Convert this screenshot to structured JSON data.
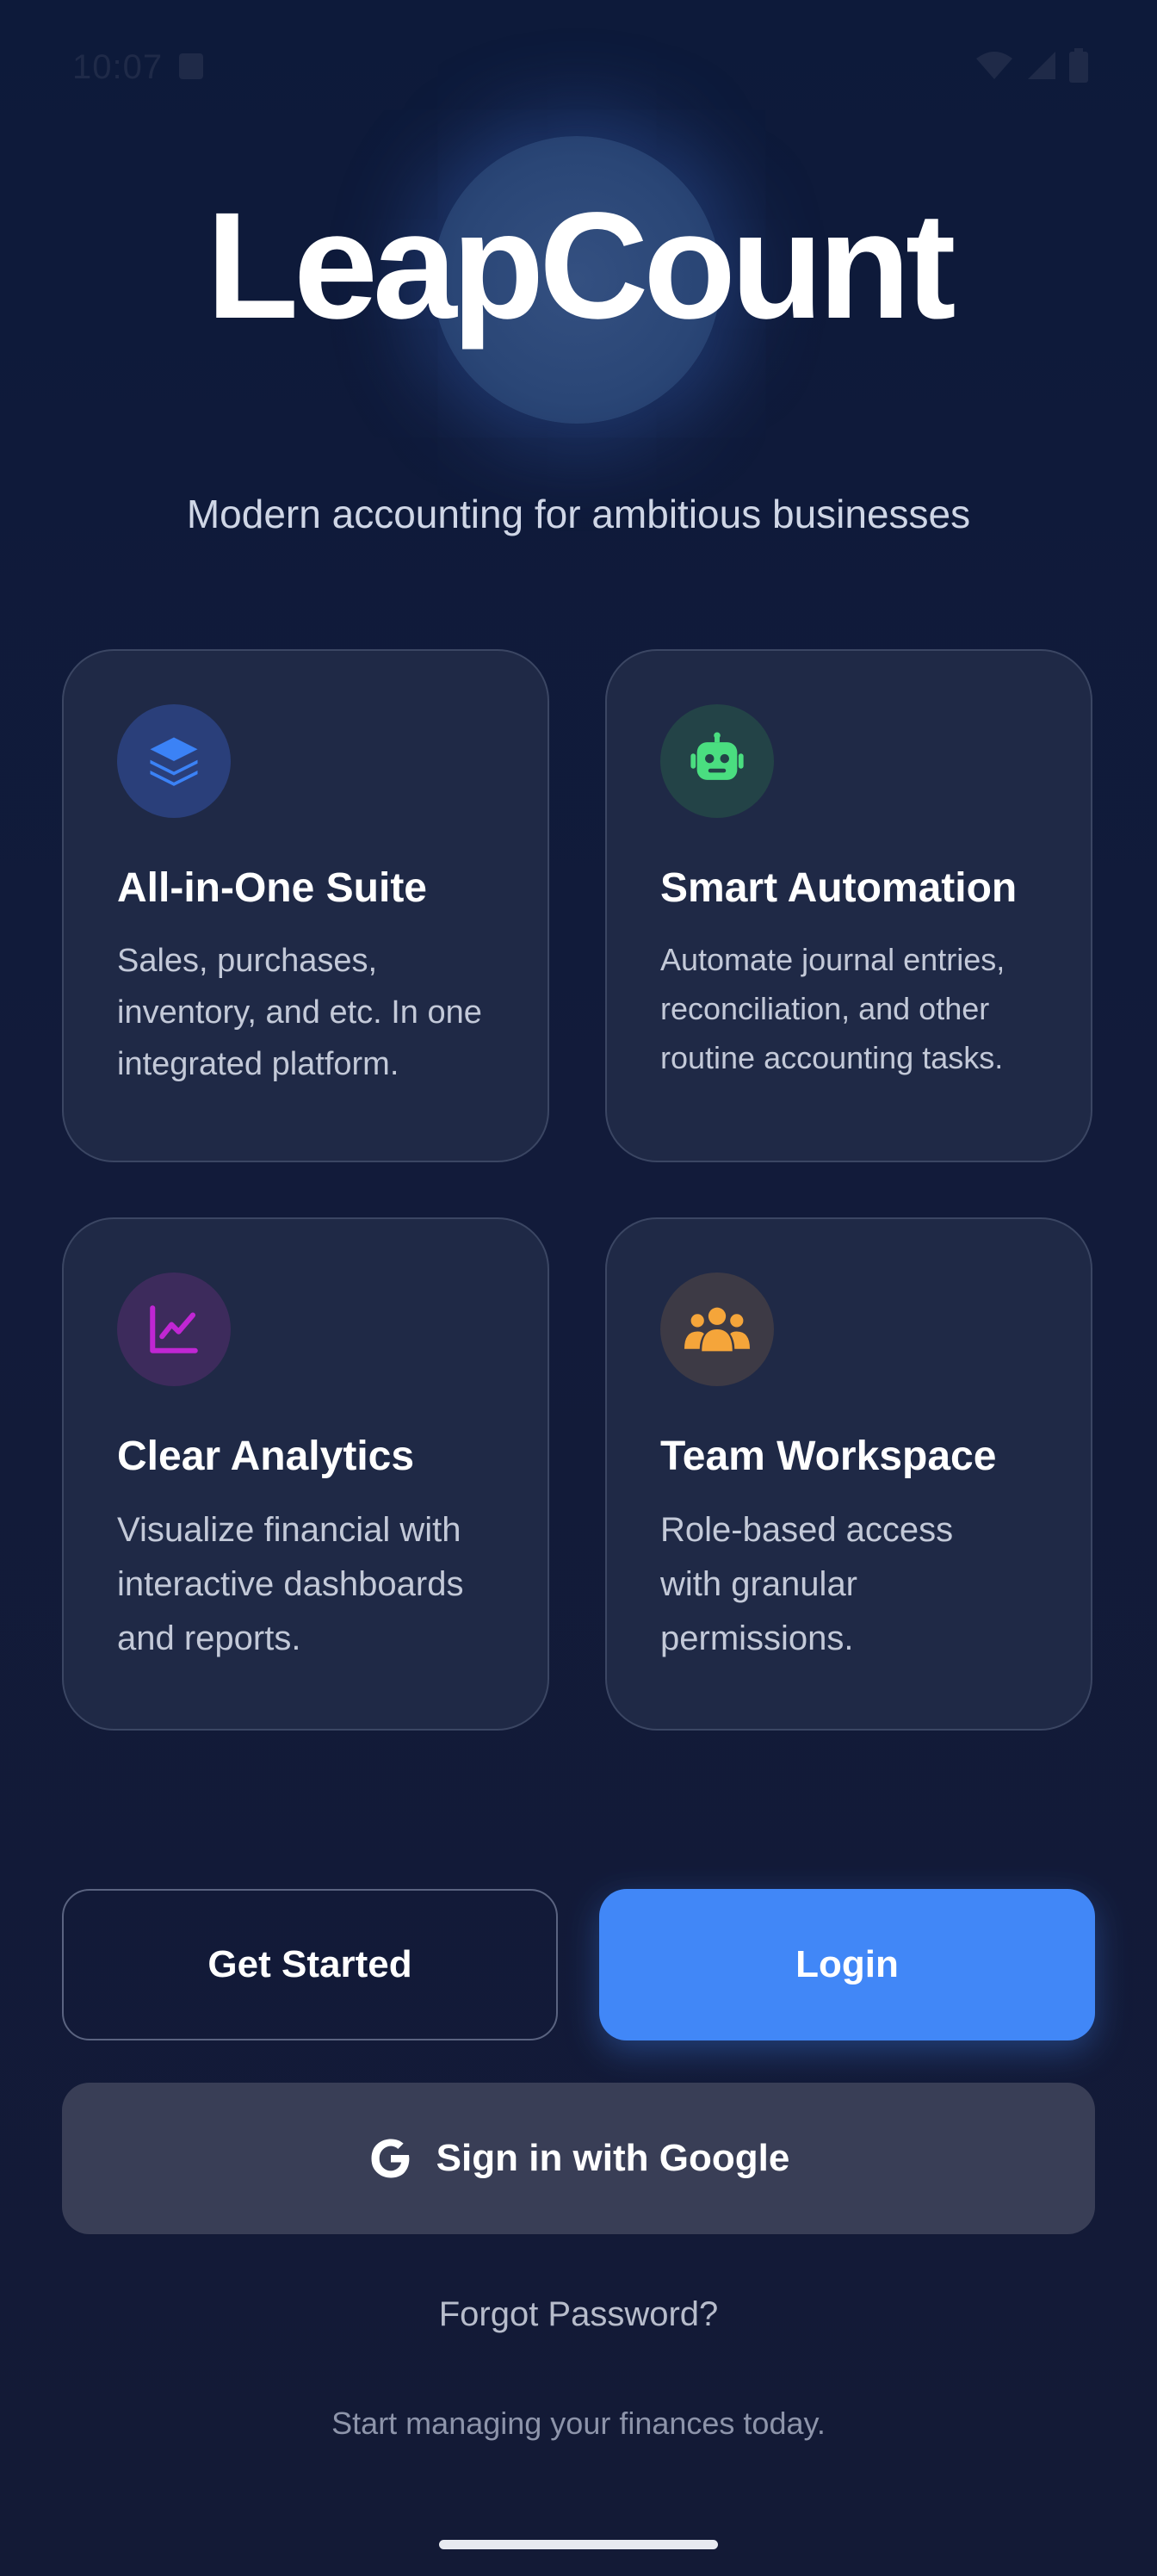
{
  "status_bar": {
    "time": "10:07"
  },
  "app": {
    "logo_text": "LeapCount",
    "tagline": "Modern accounting for ambitious businesses"
  },
  "features": [
    {
      "icon": "layers-icon",
      "color": "#3b82f6",
      "title": "All-in-One Suite",
      "description": "Sales, purchases, inventory, and etc. In one integrated platform."
    },
    {
      "icon": "robot-icon",
      "color": "#4ade80",
      "title": "Smart Automation",
      "description": "Automate journal entries, reconciliation, and other routine accounting tasks."
    },
    {
      "icon": "chart-line-icon",
      "color": "#c026d3",
      "title": "Clear Analytics",
      "description": "Visualize financial with interactive dashboards and reports."
    },
    {
      "icon": "team-icon",
      "color": "#f5a53a",
      "title": "Team Workspace",
      "description": "Role-based access with granular permissions."
    }
  ],
  "actions": {
    "get_started": "Get Started",
    "login": "Login",
    "google": "Sign in with Google",
    "forgot_password": "Forgot Password?"
  },
  "footer": {
    "text": "Start managing your finances today."
  },
  "colors": {
    "accent": "#4187f7",
    "background": "#121b3a",
    "card": "#1f2946"
  }
}
